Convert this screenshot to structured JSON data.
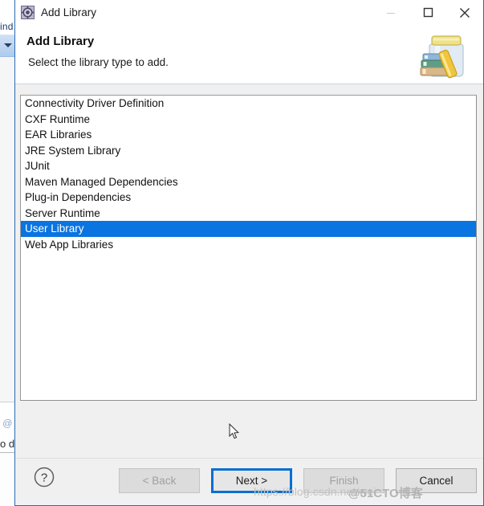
{
  "window": {
    "title": "Add Library",
    "icon": "gear-icon",
    "controls": {
      "minimize": "minimize-icon",
      "maximize": "maximize-icon",
      "close": "close-icon"
    }
  },
  "header": {
    "title": "Add Library",
    "subtitle": "Select the library type to add.",
    "image": "library-jar-icon"
  },
  "list": {
    "name": "library-type-list",
    "selected_index": 8,
    "items": [
      "Connectivity Driver Definition",
      "CXF Runtime",
      "EAR Libraries",
      "JRE System Library",
      "JUnit",
      "Maven Managed Dependencies",
      "Plug-in Dependencies",
      "Server Runtime",
      "User Library",
      "Web App Libraries"
    ]
  },
  "footer": {
    "help_label": "?",
    "buttons": [
      {
        "label": "< Back",
        "name": "back-button",
        "state": "disabled"
      },
      {
        "label": "Next >",
        "name": "next-button",
        "state": "focused"
      },
      {
        "label": "Finish",
        "name": "finish-button",
        "state": "disabled"
      },
      {
        "label": "Cancel",
        "name": "cancel-button",
        "state": "enabled"
      }
    ]
  },
  "background": {
    "menu_fragment": "ind",
    "at_fragment": "@",
    "text_fragment": "o d"
  },
  "watermark": {
    "url": "https://blog.csdn.net/wei",
    "suffix": "@51CTO博客"
  },
  "colors": {
    "selection_blue": "#0a74e0",
    "focus_blue": "#0a6ed1",
    "dialog_border": "#2a6ab5",
    "dialog_face": "#f0f0f0"
  }
}
